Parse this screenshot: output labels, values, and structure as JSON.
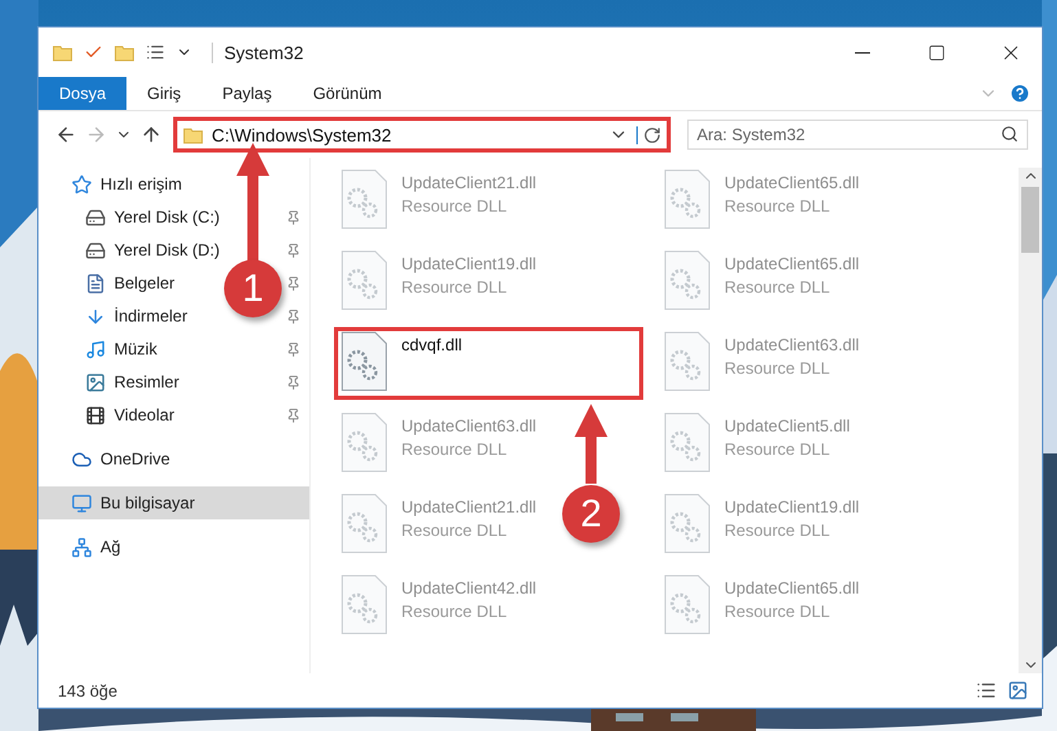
{
  "window": {
    "title": "System32"
  },
  "ribbon_tabs": [
    {
      "label": "Dosya",
      "selected": true
    },
    {
      "label": "Giriş",
      "selected": false
    },
    {
      "label": "Paylaş",
      "selected": false
    },
    {
      "label": "Görünüm",
      "selected": false
    }
  ],
  "address": {
    "path": "C:\\Windows\\System32",
    "highlighted": true
  },
  "search": {
    "placeholder": "Ara: System32"
  },
  "sidebar": [
    {
      "label": "Hızlı erişim",
      "selected": false,
      "children": [
        {
          "label": "Yerel Disk (C:)",
          "pinned": true
        },
        {
          "label": "Yerel Disk (D:)",
          "pinned": true
        },
        {
          "label": "Belgeler",
          "pinned": true
        },
        {
          "label": "İndirmeler",
          "pinned": true
        },
        {
          "label": "Müzik",
          "pinned": true
        },
        {
          "label": "Resimler",
          "pinned": true
        },
        {
          "label": "Videolar",
          "pinned": true
        }
      ]
    },
    {
      "label": "OneDrive",
      "selected": false
    },
    {
      "label": "Bu bilgisayar",
      "selected": true
    },
    {
      "label": "Ağ",
      "selected": false
    }
  ],
  "files": [
    {
      "name": "UpdateClient21.dll",
      "type": "Resource DLL",
      "blurred": true,
      "highlighted": false
    },
    {
      "name": "UpdateClient65.dll",
      "type": "Resource DLL",
      "blurred": true,
      "highlighted": false
    },
    {
      "name": "UpdateClient19.dll",
      "type": "Resource DLL",
      "blurred": true,
      "highlighted": false
    },
    {
      "name": "UpdateClient65.dll",
      "type": "Resource DLL",
      "blurred": true,
      "highlighted": false
    },
    {
      "name": "cdvqf.dll",
      "blurred": false,
      "highlighted": true
    },
    {
      "name": "UpdateClient63.dll",
      "type": "Resource DLL",
      "blurred": true,
      "highlighted": false
    },
    {
      "name": "UpdateClient63.dll",
      "type": "Resource DLL",
      "blurred": true,
      "highlighted": false
    },
    {
      "name": "UpdateClient5.dll",
      "type": "Resource DLL",
      "blurred": true,
      "highlighted": false
    },
    {
      "name": "UpdateClient21.dll",
      "type": "Resource DLL",
      "blurred": true,
      "highlighted": false
    },
    {
      "name": "UpdateClient19.dll",
      "type": "Resource DLL",
      "blurred": true,
      "highlighted": false
    },
    {
      "name": "UpdateClient42.dll",
      "type": "Resource DLL",
      "blurred": true,
      "highlighted": false
    },
    {
      "name": "UpdateClient65.dll",
      "type": "Resource DLL",
      "blurred": true,
      "highlighted": false
    }
  ],
  "status_bar": {
    "count": "143 öğe"
  },
  "annotations": [
    {
      "label": "1"
    },
    {
      "label": "2"
    }
  ]
}
